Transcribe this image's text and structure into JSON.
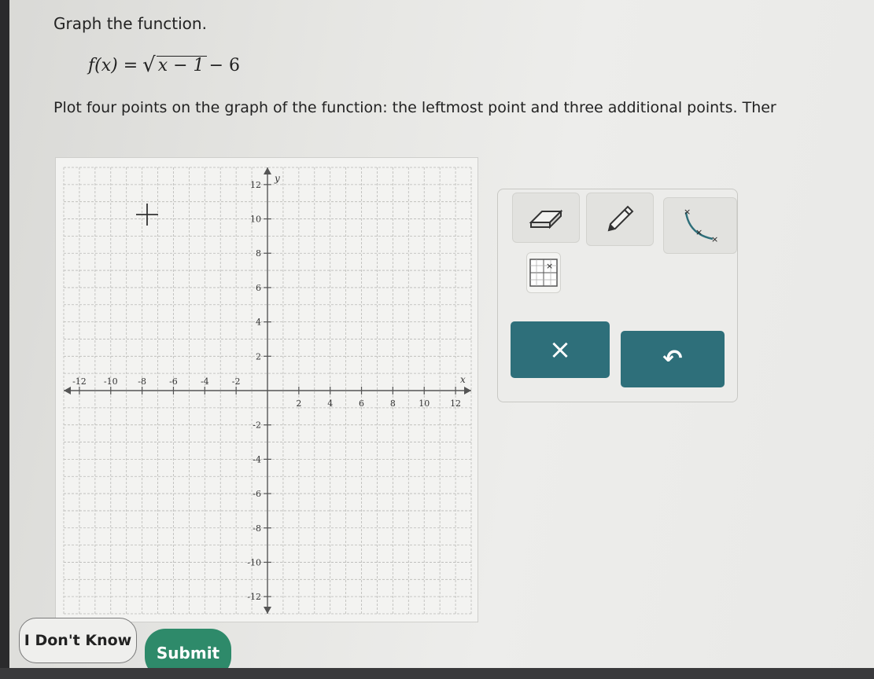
{
  "question": {
    "instruction": "Graph the function.",
    "formula": {
      "lhs": "f(x) =",
      "radical": "√",
      "radicand": "x − 1",
      "tail": "− 6"
    },
    "directions": "Plot four points on the graph of the function: the leftmost point and three additional points. Ther"
  },
  "graph": {
    "x_axis_label": "x",
    "y_axis_label": "y",
    "x_range": [
      -13,
      13
    ],
    "y_range": [
      -13,
      13
    ],
    "x_tick_labels": [
      "-12",
      "-10",
      "-8",
      "-6",
      "-4",
      "-2",
      "2",
      "4",
      "6",
      "8",
      "10",
      "12"
    ],
    "y_tick_labels": [
      "12",
      "10",
      "8",
      "6",
      "4",
      "2",
      "-2",
      "-4",
      "-6",
      "-8",
      "-10",
      "-12"
    ],
    "grid": true
  },
  "tools": {
    "eraser": "eraser-icon",
    "pencil": "pencil-icon",
    "curve": "curve-points-icon",
    "point_plot": "point-plot-icon",
    "clear": "×",
    "undo": "↶",
    "accent_color": "#2e6f7a"
  },
  "buttons": {
    "dont_know": "I Don't Know",
    "submit": "Submit",
    "submit_color": "#2e8a6a"
  }
}
